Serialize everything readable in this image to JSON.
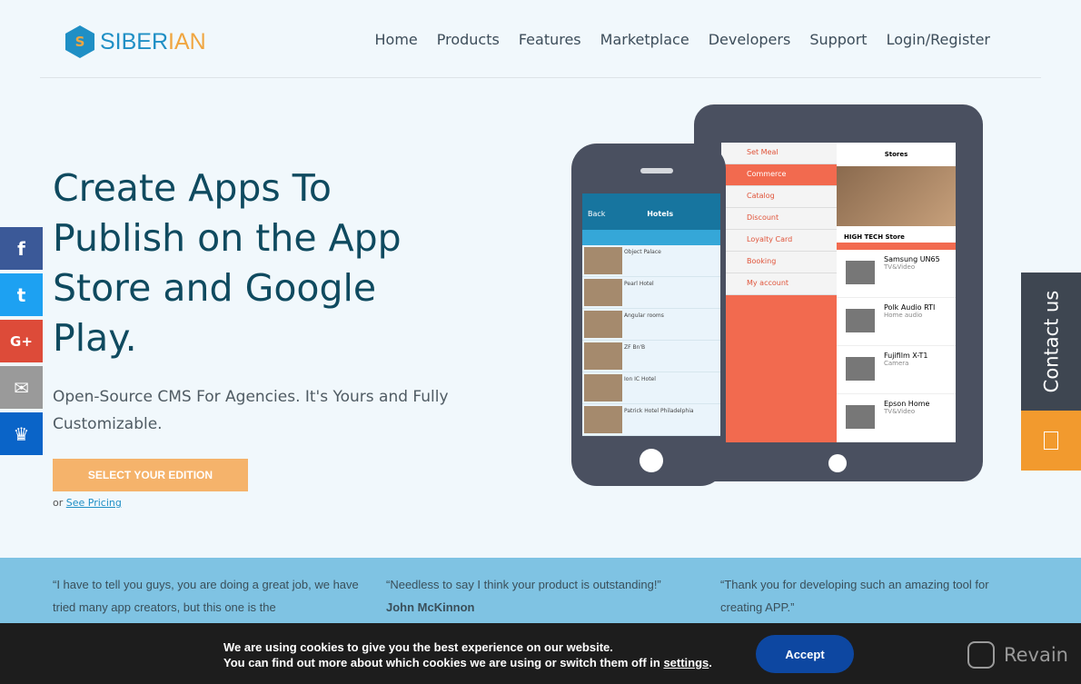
{
  "brand": {
    "part1": "SIBER",
    "part2": "IAN",
    "mark": "S"
  },
  "nav": [
    "Home",
    "Products",
    "Features",
    "Marketplace",
    "Developers",
    "Support",
    "Login/Register"
  ],
  "hero": {
    "title": "Create Apps To Publish on the App Store and Google Play.",
    "subtitle": "Open-Source CMS For Agencies. It's Yours and Fully Customizable.",
    "cta": "SELECT YOUR EDITION",
    "or": "or",
    "pricing": "See Pricing"
  },
  "social": [
    "f",
    "t",
    "G+",
    "✉",
    "♛"
  ],
  "contact": "Contact us",
  "tablet": {
    "menu": [
      "Set Meal",
      "Commerce",
      "Catalog",
      "Discount",
      "Loyalty Card",
      "Booking",
      "My account"
    ],
    "stores_title": "Stores",
    "store_name": "HIGH TECH Store",
    "products": [
      {
        "name": "Samsung UN65",
        "cat": "TV&Video"
      },
      {
        "name": "Polk Audio RTI",
        "cat": "Home audio"
      },
      {
        "name": "Fujifilm X-T1",
        "cat": "Camera"
      },
      {
        "name": "Epson Home",
        "cat": "TV&Video"
      }
    ]
  },
  "phone": {
    "back": "Back",
    "title": "Hotels",
    "hotels": [
      "Object Palace",
      "Pearl Hotel",
      "Angular rooms",
      "ZF Bn'B",
      "Ion IC Hotel",
      "Patrick Hotel Philadelphia"
    ]
  },
  "testimonials": [
    {
      "text": "“I have to tell you guys, you are doing a great job, we have tried many app creators, but this one is the"
    },
    {
      "text": "“Needless to say I think your product is outstanding!”",
      "author": "John McKinnon"
    },
    {
      "text": "“Thank you for developing such an amazing tool for creating APP.”"
    }
  ],
  "cookie": {
    "line1": "We are using cookies to give you the best experience on our website.",
    "line2": "You can find out more about which cookies we are using or switch them off in",
    "link": "settings",
    "end": ".",
    "accept": "Accept"
  },
  "revain": "Revain",
  "colors": {
    "primary": "#0f4a5f",
    "accent": "#f5b36b",
    "brand_blue": "#1f8fc5",
    "testimonial_bg": "#7fc3e3"
  }
}
